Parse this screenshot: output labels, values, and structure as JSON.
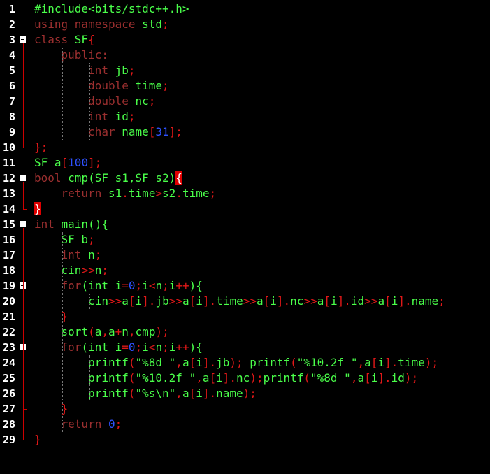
{
  "colors": {
    "background": "#000000",
    "keyword": "#9b2f2f",
    "identifier": "#4aff4a",
    "operator": "#e01818",
    "number": "#2e52ff",
    "line_number": "#ffffff",
    "fold_guide": "#cc0000",
    "brace_highlight": "#e00000"
  },
  "lines": [
    {
      "n": "1",
      "segs": [
        [
          "#include<bits/stdc++.h>",
          "g"
        ]
      ]
    },
    {
      "n": "2",
      "segs": [
        [
          "using namespace ",
          "k"
        ],
        [
          "std",
          "g"
        ],
        [
          ";",
          "o"
        ]
      ]
    },
    {
      "n": "3",
      "segs": [
        [
          "class ",
          "k"
        ],
        [
          "SF",
          "g"
        ],
        [
          "{",
          "o"
        ]
      ]
    },
    {
      "n": "4",
      "segs": [
        [
          "    ",
          "k"
        ],
        [
          "public:",
          "k"
        ]
      ]
    },
    {
      "n": "5",
      "segs": [
        [
          "        int ",
          "k"
        ],
        [
          "jb",
          "g"
        ],
        [
          ";",
          "o"
        ]
      ]
    },
    {
      "n": "6",
      "segs": [
        [
          "        double ",
          "k"
        ],
        [
          "time",
          "g"
        ],
        [
          ";",
          "o"
        ]
      ]
    },
    {
      "n": "7",
      "segs": [
        [
          "        double ",
          "k"
        ],
        [
          "nc",
          "g"
        ],
        [
          ";",
          "o"
        ]
      ]
    },
    {
      "n": "8",
      "segs": [
        [
          "        int ",
          "k"
        ],
        [
          "id",
          "g"
        ],
        [
          ";",
          "o"
        ]
      ]
    },
    {
      "n": "9",
      "segs": [
        [
          "        char ",
          "k"
        ],
        [
          "name",
          "g"
        ],
        [
          "[",
          "o"
        ],
        [
          "31",
          "n"
        ],
        [
          "];",
          "o"
        ]
      ]
    },
    {
      "n": "10",
      "segs": [
        [
          "};",
          "o"
        ]
      ]
    },
    {
      "n": "11",
      "segs": [
        [
          "SF a",
          "g"
        ],
        [
          "[",
          "o"
        ],
        [
          "100",
          "n"
        ],
        [
          "];",
          "o"
        ]
      ]
    },
    {
      "n": "12",
      "segs": [
        [
          "bool ",
          "k"
        ],
        [
          "cmp(SF s1,SF s2)",
          "g"
        ],
        [
          "{",
          "h"
        ]
      ]
    },
    {
      "n": "13",
      "segs": [
        [
          "    return ",
          "k"
        ],
        [
          "s1",
          "g"
        ],
        [
          ".",
          "o"
        ],
        [
          "time",
          "g"
        ],
        [
          ">",
          "o"
        ],
        [
          "s2",
          "g"
        ],
        [
          ".",
          "o"
        ],
        [
          "time",
          "g"
        ],
        [
          ";",
          "o"
        ]
      ]
    },
    {
      "n": "14",
      "segs": [
        [
          "}",
          "h"
        ]
      ]
    },
    {
      "n": "15",
      "segs": [
        [
          "int ",
          "k"
        ],
        [
          "main(){",
          "g"
        ]
      ]
    },
    {
      "n": "16",
      "segs": [
        [
          "    SF b",
          "g"
        ],
        [
          ";",
          "o"
        ]
      ]
    },
    {
      "n": "17",
      "segs": [
        [
          "    int ",
          "k"
        ],
        [
          "n",
          "g"
        ],
        [
          ";",
          "o"
        ]
      ]
    },
    {
      "n": "18",
      "segs": [
        [
          "    cin",
          "g"
        ],
        [
          ">>",
          "o"
        ],
        [
          "n",
          "g"
        ],
        [
          ";",
          "o"
        ]
      ]
    },
    {
      "n": "19",
      "segs": [
        [
          "    for",
          "k"
        ],
        [
          "(int ",
          "g"
        ],
        [
          "i",
          "g"
        ],
        [
          "=",
          "o"
        ],
        [
          "0",
          "n"
        ],
        [
          ";",
          "o"
        ],
        [
          "i",
          "g"
        ],
        [
          "<",
          "o"
        ],
        [
          "n",
          "g"
        ],
        [
          ";",
          "o"
        ],
        [
          "i",
          "g"
        ],
        [
          "++",
          "o"
        ],
        [
          "){",
          "g"
        ]
      ]
    },
    {
      "n": "20",
      "segs": [
        [
          "        cin",
          "g"
        ],
        [
          ">>",
          "o"
        ],
        [
          "a",
          "g"
        ],
        [
          "[",
          "o"
        ],
        [
          "i",
          "g"
        ],
        [
          "]",
          "o"
        ],
        [
          ".",
          "o"
        ],
        [
          "jb",
          "g"
        ],
        [
          ">>",
          "o"
        ],
        [
          "a",
          "g"
        ],
        [
          "[",
          "o"
        ],
        [
          "i",
          "g"
        ],
        [
          "]",
          "o"
        ],
        [
          ".",
          "o"
        ],
        [
          "time",
          "g"
        ],
        [
          ">>",
          "o"
        ],
        [
          "a",
          "g"
        ],
        [
          "[",
          "o"
        ],
        [
          "i",
          "g"
        ],
        [
          "]",
          "o"
        ],
        [
          ".",
          "o"
        ],
        [
          "nc",
          "g"
        ],
        [
          ">>",
          "o"
        ],
        [
          "a",
          "g"
        ],
        [
          "[",
          "o"
        ],
        [
          "i",
          "g"
        ],
        [
          "]",
          "o"
        ],
        [
          ".",
          "o"
        ],
        [
          "id",
          "g"
        ],
        [
          ">>",
          "o"
        ],
        [
          "a",
          "g"
        ],
        [
          "[",
          "o"
        ],
        [
          "i",
          "g"
        ],
        [
          "]",
          "o"
        ],
        [
          ".",
          "o"
        ],
        [
          "name",
          "g"
        ],
        [
          ";",
          "o"
        ]
      ]
    },
    {
      "n": "21",
      "segs": [
        [
          "    }",
          "o"
        ]
      ]
    },
    {
      "n": "22",
      "segs": [
        [
          "    sort",
          "g"
        ],
        [
          "(",
          "o"
        ],
        [
          "a",
          "g"
        ],
        [
          ",",
          "o"
        ],
        [
          "a",
          "g"
        ],
        [
          "+",
          "o"
        ],
        [
          "n",
          "g"
        ],
        [
          ",",
          "o"
        ],
        [
          "cmp",
          "g"
        ],
        [
          ");",
          "o"
        ]
      ]
    },
    {
      "n": "23",
      "segs": [
        [
          "    for",
          "k"
        ],
        [
          "(int ",
          "g"
        ],
        [
          "i",
          "g"
        ],
        [
          "=",
          "o"
        ],
        [
          "0",
          "n"
        ],
        [
          ";",
          "o"
        ],
        [
          "i",
          "g"
        ],
        [
          "<",
          "o"
        ],
        [
          "n",
          "g"
        ],
        [
          ";",
          "o"
        ],
        [
          "i",
          "g"
        ],
        [
          "++",
          "o"
        ],
        [
          "){",
          "g"
        ]
      ]
    },
    {
      "n": "24",
      "segs": [
        [
          "        printf",
          "g"
        ],
        [
          "(",
          "o"
        ],
        [
          "\"%8d \"",
          "g"
        ],
        [
          ",",
          "o"
        ],
        [
          "a",
          "g"
        ],
        [
          "[",
          "o"
        ],
        [
          "i",
          "g"
        ],
        [
          "]",
          "o"
        ],
        [
          ".",
          "o"
        ],
        [
          "jb",
          "g"
        ],
        [
          ");",
          "o"
        ],
        [
          " printf",
          "g"
        ],
        [
          "(",
          "o"
        ],
        [
          "\"%10.2f \"",
          "g"
        ],
        [
          ",",
          "o"
        ],
        [
          "a",
          "g"
        ],
        [
          "[",
          "o"
        ],
        [
          "i",
          "g"
        ],
        [
          "]",
          "o"
        ],
        [
          ".",
          "o"
        ],
        [
          "time",
          "g"
        ],
        [
          ");",
          "o"
        ]
      ]
    },
    {
      "n": "25",
      "segs": [
        [
          "        printf",
          "g"
        ],
        [
          "(",
          "o"
        ],
        [
          "\"%10.2f \"",
          "g"
        ],
        [
          ",",
          "o"
        ],
        [
          "a",
          "g"
        ],
        [
          "[",
          "o"
        ],
        [
          "i",
          "g"
        ],
        [
          "]",
          "o"
        ],
        [
          ".",
          "o"
        ],
        [
          "nc",
          "g"
        ],
        [
          ");",
          "o"
        ],
        [
          "printf",
          "g"
        ],
        [
          "(",
          "o"
        ],
        [
          "\"%8d \"",
          "g"
        ],
        [
          ",",
          "o"
        ],
        [
          "a",
          "g"
        ],
        [
          "[",
          "o"
        ],
        [
          "i",
          "g"
        ],
        [
          "]",
          "o"
        ],
        [
          ".",
          "o"
        ],
        [
          "id",
          "g"
        ],
        [
          ");",
          "o"
        ]
      ]
    },
    {
      "n": "26",
      "segs": [
        [
          "        printf",
          "g"
        ],
        [
          "(",
          "o"
        ],
        [
          "\"%s\\n\"",
          "g"
        ],
        [
          ",",
          "o"
        ],
        [
          "a",
          "g"
        ],
        [
          "[",
          "o"
        ],
        [
          "i",
          "g"
        ],
        [
          "]",
          "o"
        ],
        [
          ".",
          "o"
        ],
        [
          "name",
          "g"
        ],
        [
          ");",
          "o"
        ]
      ]
    },
    {
      "n": "27",
      "segs": [
        [
          "    }",
          "o"
        ]
      ]
    },
    {
      "n": "28",
      "segs": [
        [
          "    return ",
          "k"
        ],
        [
          "0",
          "n"
        ],
        [
          ";",
          "o"
        ]
      ]
    },
    {
      "n": "29",
      "segs": [
        [
          "}",
          "o"
        ]
      ]
    }
  ]
}
